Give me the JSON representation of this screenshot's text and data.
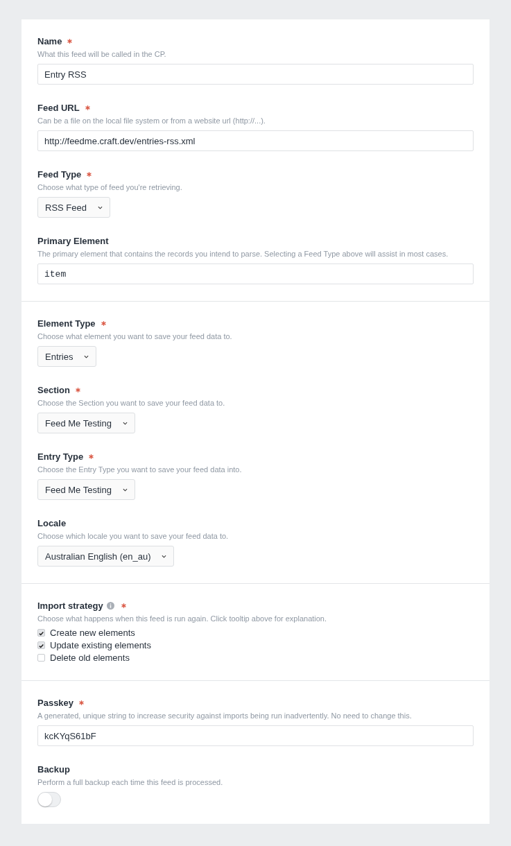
{
  "sections": [
    {
      "fields": [
        {
          "kind": "text",
          "label": "Name",
          "required": true,
          "help": "What this feed will be called in the CP.",
          "value": "Entry RSS"
        },
        {
          "kind": "text",
          "label": "Feed URL",
          "required": true,
          "help": "Can be a file on the local file system or from a website url (http://...).",
          "value": "http://feedme.craft.dev/entries-rss.xml"
        },
        {
          "kind": "select",
          "label": "Feed Type",
          "required": true,
          "help": "Choose what type of feed you're retrieving.",
          "value": "RSS Feed"
        },
        {
          "kind": "code",
          "label": "Primary Element",
          "required": false,
          "help": "The primary element that contains the records you intend to parse. Selecting a Feed Type above will assist in most cases.",
          "value": "item"
        }
      ]
    },
    {
      "fields": [
        {
          "kind": "select",
          "label": "Element Type",
          "required": true,
          "help": "Choose what element you want to save your feed data to.",
          "value": "Entries"
        },
        {
          "kind": "select",
          "label": "Section",
          "required": true,
          "help": "Choose the Section you want to save your feed data to.",
          "value": "Feed Me Testing"
        },
        {
          "kind": "select",
          "label": "Entry Type",
          "required": true,
          "help": "Choose the Entry Type you want to save your feed data into.",
          "value": "Feed Me Testing"
        },
        {
          "kind": "select",
          "label": "Locale",
          "required": false,
          "help": "Choose which locale you want to save your feed data to.",
          "value": "Australian English (en_au)"
        }
      ]
    },
    {
      "fields": [
        {
          "kind": "checkboxes",
          "label": "Import strategy",
          "info": true,
          "required": true,
          "help": "Choose what happens when this feed is run again. Click tooltip above for explanation.",
          "options": [
            {
              "label": "Create new elements",
              "checked": true
            },
            {
              "label": "Update existing elements",
              "checked": true
            },
            {
              "label": "Delete old elements",
              "checked": false
            }
          ]
        }
      ]
    },
    {
      "fields": [
        {
          "kind": "text",
          "label": "Passkey",
          "required": true,
          "help": "A generated, unique string to increase security against imports being run inadvertently. No need to change this.",
          "value": "kcKYqS61bF"
        },
        {
          "kind": "toggle",
          "label": "Backup",
          "required": false,
          "help": "Perform a full backup each time this feed is processed.",
          "on": false
        }
      ]
    }
  ]
}
